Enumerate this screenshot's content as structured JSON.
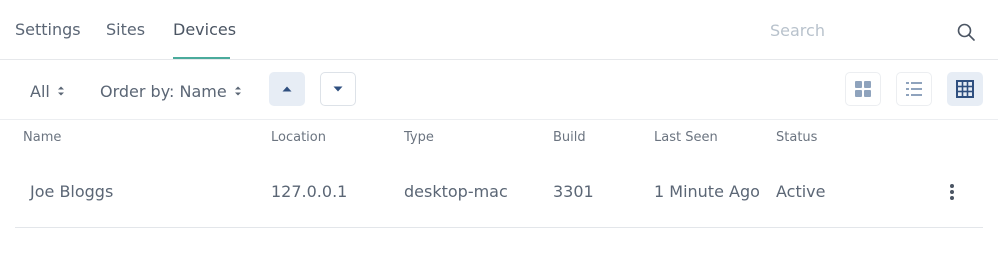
{
  "tabs": {
    "settings": "Settings",
    "sites": "Sites",
    "devices": "Devices"
  },
  "search": {
    "placeholder": "Search",
    "value": ""
  },
  "toolbar": {
    "filter": "All",
    "order_by": "Order by: Name",
    "active_view": "table"
  },
  "table": {
    "headers": [
      "Name",
      "Location",
      "Type",
      "Build",
      "Last Seen",
      "Status"
    ],
    "rows": [
      {
        "name": "Joe Bloggs",
        "location": "127.0.0.1",
        "type": "desktop-mac",
        "build": "3301",
        "last_seen": "1 Minute Ago",
        "status": "Active"
      }
    ]
  },
  "colors": {
    "accent": "#4aab9c",
    "active_button_bg": "#e7edf5",
    "icon_blue": "#2f4f7f",
    "icon_grey": "#8fa3bd"
  }
}
